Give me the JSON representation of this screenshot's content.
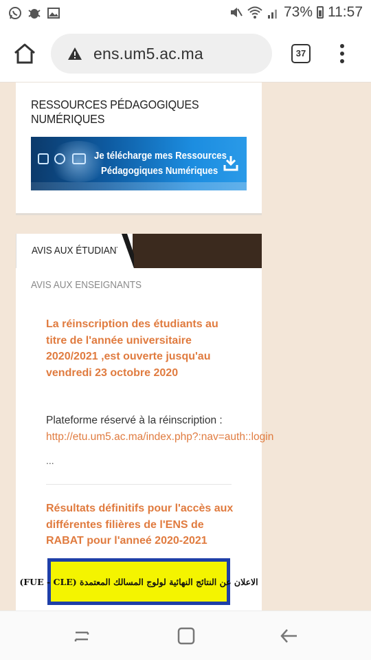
{
  "status_bar": {
    "battery": "73%",
    "time": "11:57",
    "left_icons": [
      "whatsapp-icon",
      "bug-icon",
      "image-icon"
    ],
    "right_icons": [
      "mute-icon",
      "wifi-icon",
      "signal-icon",
      "battery-icon"
    ]
  },
  "browser": {
    "url": "ens.um5.ac.ma",
    "tab_count": "37"
  },
  "resources": {
    "title": "RESSOURCES PÉDAGOGIQUES NUMÉRIQUES",
    "banner_line1": "Je télécharge mes Ressources",
    "banner_line2": "Pédagogiques Numériques"
  },
  "tabs": {
    "active": "AVIS AUX ÉTUDIANTS",
    "inactive": "AVIS AUX ENSEIGNANTS"
  },
  "posts": [
    {
      "title": "La réinscription des étudiants au titre de l'année universitaire 2020/2021 ,est ouverte jusqu'au vendredi 23 octobre 2020",
      "body": "Plateforme réservé à la réinscription :",
      "link": "http://etu.um5.ac.ma/index.php?:nav=auth::login",
      "more": "..."
    },
    {
      "title": "Résultats définitifs pour l'accès aux différentes filières de l'ENS de RABAT pour l'anneé 2020-2021",
      "image_text": "الاعلان عن النتائج النهائية لولوج المسالك المعتمدة (FUE - CLE)"
    }
  ]
}
